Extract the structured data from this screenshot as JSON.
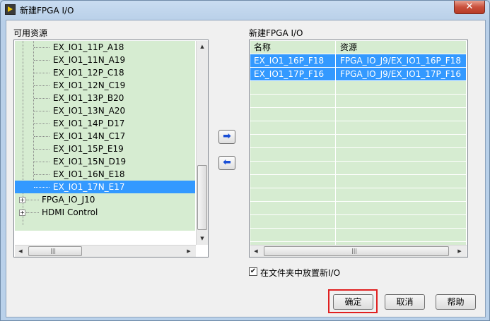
{
  "window": {
    "title": "新建FPGA I/O",
    "close_glyph": "✕"
  },
  "left": {
    "label": "可用资源",
    "items": [
      {
        "label": "EX_IO1_11P_A18"
      },
      {
        "label": "EX_IO1_11N_A19"
      },
      {
        "label": "EX_IO1_12P_C18"
      },
      {
        "label": "EX_IO1_12N_C19"
      },
      {
        "label": "EX_IO1_13P_B20"
      },
      {
        "label": "EX_IO1_13N_A20"
      },
      {
        "label": "EX_IO1_14P_D17"
      },
      {
        "label": "EX_IO1_14N_C17"
      },
      {
        "label": "EX_IO1_15P_E19"
      },
      {
        "label": "EX_IO1_15N_D19"
      },
      {
        "label": "EX_IO1_16N_E18"
      },
      {
        "label": "EX_IO1_17N_E17",
        "selected": true
      }
    ],
    "groups": [
      {
        "label": "FPGA_IO_J10",
        "expander": "+"
      },
      {
        "label": "HDMI Control",
        "expander": "+"
      }
    ]
  },
  "move": {
    "add_glyph": "➡",
    "remove_glyph": "⬅"
  },
  "right": {
    "label": "新建FPGA I/O",
    "columns": [
      "名称",
      "资源"
    ],
    "rows": [
      {
        "name": "EX_IO1_16P_F18",
        "resource": "FPGA_IO_J9/EX_IO1_16P_F18"
      },
      {
        "name": "EX_IO1_17P_F16",
        "resource": "FPGA_IO_J9/EX_IO1_17P_F16"
      }
    ]
  },
  "scroll": {
    "up": "▲",
    "down": "▼",
    "left": "◀",
    "right": "▶",
    "grip": "|||"
  },
  "checkbox": {
    "label": "在文件夹中放置新I/O",
    "checked": true,
    "mark": "✔"
  },
  "buttons": {
    "ok": "确定",
    "cancel": "取消",
    "help": "帮助"
  }
}
